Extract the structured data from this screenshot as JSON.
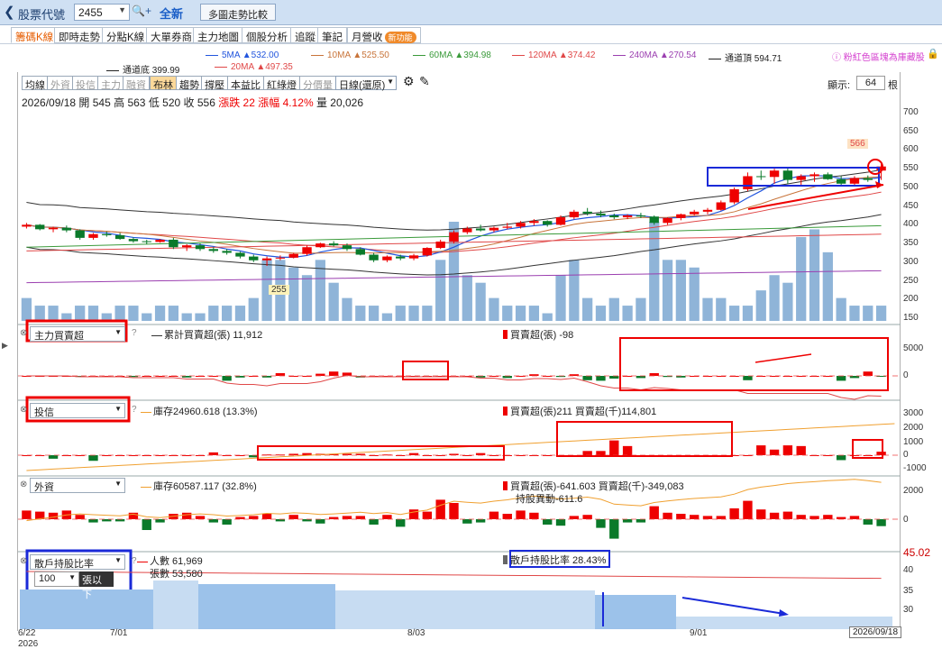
{
  "topbar": {
    "label": "股票代號",
    "stock": "2455",
    "new": "全新",
    "compare": "多圖走勢比較"
  },
  "tabs": [
    {
      "label": "籌碼K線"
    },
    {
      "label": "即時走勢"
    },
    {
      "label": "分點K線"
    },
    {
      "label": "大單券商"
    },
    {
      "label": "主力地圖"
    },
    {
      "label": "個股分析"
    },
    {
      "label": "追蹤"
    },
    {
      "label": "筆記"
    },
    {
      "label": "月營收"
    }
  ],
  "new_badge": "新功能",
  "ma_legend": [
    {
      "text": "5MA ▲532.00",
      "color": "#2255dd"
    },
    {
      "text": "10MA ▲525.50",
      "color": "#c8743a"
    },
    {
      "text": "60MA ▲394.98",
      "color": "#3a9a3a"
    },
    {
      "text": "120MA ▲374.42",
      "color": "#e04848"
    },
    {
      "text": "240MA ▲270.54",
      "color": "#9b3fb0"
    },
    {
      "text": "通道頂 594.71",
      "color": "#222222"
    },
    {
      "text": "通道底 399.99",
      "color": "#222222"
    },
    {
      "text": "20MA ▲497.35",
      "color": "#e04848"
    }
  ],
  "hint": "粉紅色區塊為庫藏股",
  "toolbar": [
    {
      "label": "均線",
      "state": "normal"
    },
    {
      "label": "外資",
      "state": "dis"
    },
    {
      "label": "投信",
      "state": "dis"
    },
    {
      "label": "主力",
      "state": "dis"
    },
    {
      "label": "融資",
      "state": "dis"
    },
    {
      "label": "布林",
      "state": "on"
    },
    {
      "label": "趨勢",
      "state": "normal"
    },
    {
      "label": "撐壓",
      "state": "normal"
    },
    {
      "label": "本益比",
      "state": "normal"
    },
    {
      "label": "紅綠燈",
      "state": "normal"
    },
    {
      "label": "分價量",
      "state": "dis"
    }
  ],
  "period": "日線(還原)",
  "display": {
    "label": "顯示:",
    "value": "64",
    "unit": "根"
  },
  "ohlc": {
    "date": "2026/09/18",
    "open": "開 545",
    "high": "高 563",
    "low": "低 520",
    "close": "收 556",
    "chg": "漲跌 22",
    "pct": "漲幅 4.12%",
    "vol": "量 20,026"
  },
  "price_labels": {
    "high": "566",
    "low": "255"
  },
  "panels": {
    "p1": {
      "select": "主力買賣超",
      "t1": "累計買賣超(張) 11,912",
      "t2": "買賣超(張) -98"
    },
    "p2": {
      "select": "投信",
      "t1": "庫存24960.618 (13.3%)",
      "t2": "買賣超(張)211 買賣超(千)114,801"
    },
    "p3": {
      "select": "外資",
      "t1": "庫存60587.117 (32.8%)",
      "t2": "買賣超(張)-641.603 買賣超(千)-349,083",
      "t3": "持股異動-611.6"
    },
    "p4": {
      "select": "散戶持股比率",
      "t1": "人數 61,969",
      "t2": "張數 53,580",
      "t3": "散戶持股比率 28.43%",
      "count": "100",
      "countlbl": "張以下",
      "top": "45.02"
    }
  },
  "axes": {
    "price": [
      "700",
      "650",
      "600",
      "550",
      "500",
      "450",
      "400",
      "350",
      "300",
      "250",
      "200",
      "150"
    ],
    "p1": [
      "5000",
      "0"
    ],
    "p2": [
      "3000",
      "2000",
      "1000",
      "0",
      "-1000"
    ],
    "p3": [
      "2000",
      "0"
    ],
    "p4": [
      "40",
      "35",
      "30"
    ]
  },
  "xaxis": {
    "d1": "6/22",
    "y1": "2026",
    "d2": "7/01",
    "d3": "8/03",
    "d4": "9/01",
    "last": "2026/09/18"
  },
  "chart_data": {
    "type": "candlestick",
    "candles": [
      [
        395,
        405,
        390,
        400
      ],
      [
        400,
        402,
        385,
        388
      ],
      [
        388,
        395,
        380,
        392
      ],
      [
        392,
        398,
        380,
        385
      ],
      [
        385,
        388,
        360,
        365
      ],
      [
        365,
        378,
        360,
        375
      ],
      [
        375,
        382,
        368,
        372
      ],
      [
        372,
        378,
        360,
        362
      ],
      [
        362,
        366,
        352,
        356
      ],
      [
        356,
        360,
        348,
        354
      ],
      [
        354,
        362,
        352,
        360
      ],
      [
        360,
        365,
        335,
        340
      ],
      [
        340,
        348,
        330,
        345
      ],
      [
        345,
        350,
        330,
        335
      ],
      [
        335,
        340,
        325,
        330
      ],
      [
        330,
        335,
        320,
        325
      ],
      [
        325,
        328,
        310,
        315
      ],
      [
        315,
        320,
        300,
        305
      ],
      [
        305,
        315,
        290,
        310
      ],
      [
        310,
        318,
        305,
        312
      ],
      [
        312,
        325,
        310,
        322
      ],
      [
        322,
        345,
        318,
        340
      ],
      [
        340,
        352,
        338,
        350
      ],
      [
        350,
        356,
        342,
        345
      ],
      [
        345,
        350,
        330,
        335
      ],
      [
        335,
        340,
        318,
        320
      ],
      [
        320,
        325,
        300,
        305
      ],
      [
        305,
        318,
        300,
        315
      ],
      [
        315,
        320,
        305,
        310
      ],
      [
        310,
        322,
        305,
        318
      ],
      [
        318,
        340,
        315,
        338
      ],
      [
        338,
        360,
        335,
        355
      ],
      [
        355,
        385,
        350,
        380
      ],
      [
        380,
        395,
        375,
        390
      ],
      [
        390,
        400,
        382,
        385
      ],
      [
        385,
        395,
        380,
        392
      ],
      [
        392,
        405,
        388,
        395
      ],
      [
        395,
        410,
        390,
        405
      ],
      [
        405,
        415,
        398,
        410
      ],
      [
        410,
        412,
        395,
        400
      ],
      [
        400,
        425,
        398,
        420
      ],
      [
        420,
        440,
        415,
        435
      ],
      [
        435,
        445,
        425,
        430
      ],
      [
        430,
        438,
        420,
        425
      ],
      [
        425,
        430,
        415,
        420
      ],
      [
        420,
        428,
        415,
        425
      ],
      [
        425,
        432,
        418,
        422
      ],
      [
        422,
        425,
        400,
        405
      ],
      [
        405,
        420,
        400,
        418
      ],
      [
        418,
        430,
        412,
        428
      ],
      [
        428,
        440,
        425,
        435
      ],
      [
        435,
        445,
        428,
        440
      ],
      [
        440,
        465,
        438,
        460
      ],
      [
        460,
        500,
        455,
        495
      ],
      [
        495,
        540,
        490,
        530
      ],
      [
        530,
        545,
        520,
        528
      ],
      [
        528,
        550,
        510,
        545
      ],
      [
        545,
        555,
        510,
        520
      ],
      [
        520,
        535,
        505,
        530
      ],
      [
        530,
        540,
        515,
        535
      ],
      [
        535,
        540,
        520,
        522
      ],
      [
        522,
        530,
        505,
        510
      ],
      [
        510,
        530,
        505,
        525
      ],
      [
        525,
        532,
        515,
        520
      ],
      [
        545,
        563,
        520,
        556
      ]
    ],
    "volume": [
      3,
      2,
      2,
      1,
      2,
      2,
      1,
      2,
      2,
      1,
      2,
      2,
      1,
      1,
      2,
      2,
      2,
      3,
      8,
      8,
      7,
      6,
      8,
      5,
      3,
      2,
      2,
      1,
      2,
      2,
      2,
      8,
      13,
      6,
      5,
      3,
      2,
      2,
      2,
      1,
      6,
      8,
      3,
      2,
      3,
      2,
      3,
      13,
      8,
      8,
      7,
      3,
      3,
      2,
      2,
      4,
      6,
      5,
      11,
      12,
      9,
      3,
      2,
      2,
      2
    ],
    "p1_vals": [
      0,
      0,
      0,
      0,
      -200,
      0,
      0,
      0,
      -200,
      0,
      0,
      0,
      -300,
      0,
      0,
      -900,
      -300,
      0,
      -300,
      500,
      0,
      0,
      400,
      800,
      600,
      -300,
      0,
      0,
      0,
      0,
      0,
      0,
      0,
      0,
      -300,
      0,
      -400,
      0,
      300,
      0,
      -200,
      300,
      -800,
      -900,
      -500,
      0,
      -400,
      500,
      -200,
      -300,
      0,
      0,
      0,
      0,
      -800,
      0,
      0,
      0,
      0,
      0,
      0,
      -900,
      -400,
      800,
      -98
    ],
    "p2_vals": [
      0,
      0,
      -500,
      0,
      0,
      -800,
      0,
      0,
      0,
      0,
      0,
      0,
      0,
      0,
      400,
      0,
      0,
      -300,
      100,
      100,
      200,
      300,
      200,
      200,
      200,
      200,
      0,
      100,
      0,
      300,
      0,
      0,
      200,
      0,
      300,
      0,
      0,
      0,
      0,
      0,
      0,
      0,
      600,
      600,
      2100,
      1300,
      0,
      0,
      0,
      0,
      0,
      0,
      0,
      0,
      0,
      1400,
      800,
      1400,
      1300,
      0,
      0,
      -700,
      0,
      0,
      500,
      211
    ],
    "p3_vals": [
      800,
      700,
      600,
      800,
      400,
      -300,
      -200,
      -200,
      600,
      -1000,
      -300,
      500,
      600,
      300,
      -300,
      -500,
      200,
      300,
      500,
      -200,
      400,
      -200,
      -400,
      200,
      300,
      300,
      -500,
      400,
      -700,
      900,
      700,
      1800,
      1500,
      -400,
      -300,
      700,
      500,
      800,
      600,
      -500,
      -600,
      300,
      400,
      -800,
      -1800,
      -300,
      -300,
      1200,
      600,
      500,
      400,
      300,
      300,
      1000,
      1700,
      900,
      600,
      700,
      400,
      300,
      400,
      200,
      300,
      -500,
      -641
    ]
  }
}
